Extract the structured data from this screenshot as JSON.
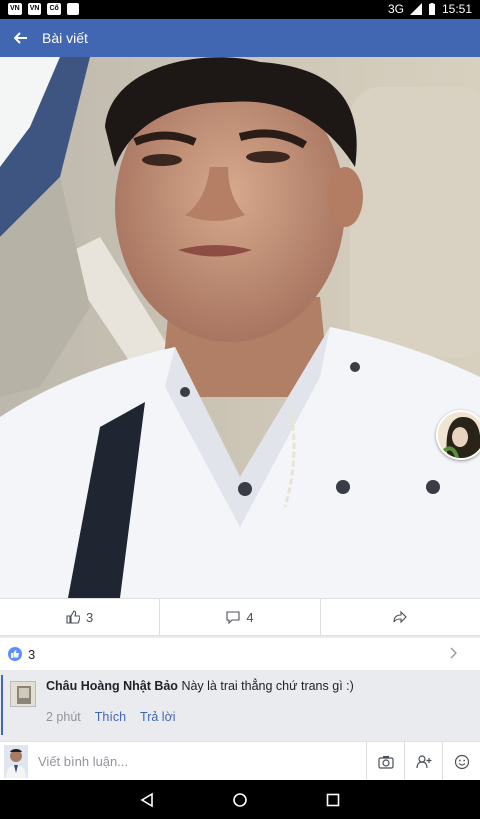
{
  "status_bar": {
    "notifications": [
      "VN",
      "VN",
      "Cố",
      ""
    ],
    "network": "3G",
    "time": "15:51"
  },
  "app_bar": {
    "title": "Bài viết"
  },
  "actions": {
    "likes": "3",
    "comments": "4"
  },
  "reactions": {
    "count": "3"
  },
  "comment": {
    "author": "Châu Hoàng Nhật Bảo",
    "text": "Này là trai thẳng chứ trans gì :)",
    "time": "2 phút",
    "like_label": "Thích",
    "reply_label": "Trả lời"
  },
  "composer": {
    "placeholder": "Viết bình luận..."
  },
  "colors": {
    "brand": "#4267b2",
    "like_blue": "#5890ff"
  }
}
